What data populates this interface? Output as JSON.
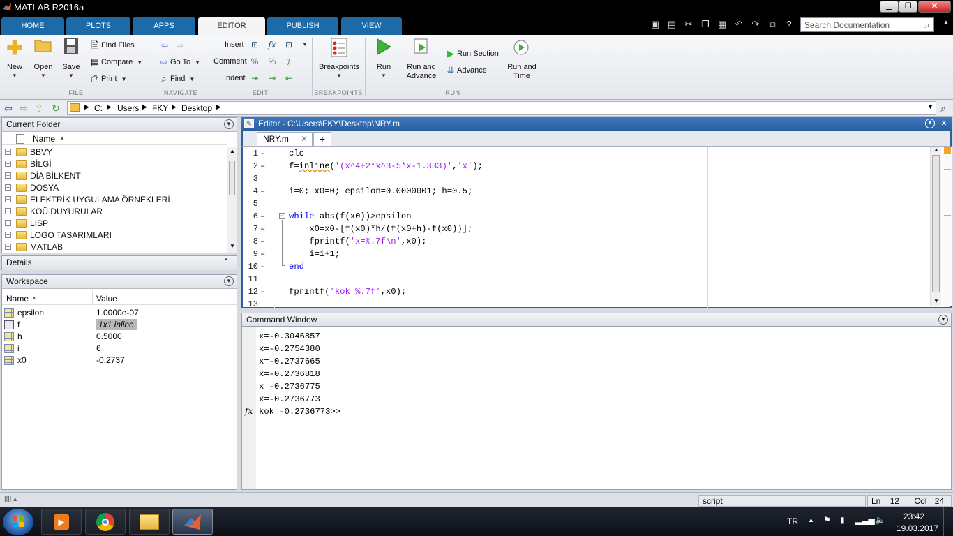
{
  "window": {
    "title": "MATLAB R2016a",
    "controls": {
      "minimize": "▁",
      "maximize": "❐",
      "close": "✕"
    }
  },
  "tabs": [
    {
      "label": "HOME",
      "active": false
    },
    {
      "label": "PLOTS",
      "active": false
    },
    {
      "label": "APPS",
      "active": false
    },
    {
      "label": "EDITOR",
      "active": true
    },
    {
      "label": "PUBLISH",
      "active": false
    },
    {
      "label": "VIEW",
      "active": false
    }
  ],
  "search": {
    "placeholder": "Search Documentation"
  },
  "ribbon": {
    "file": {
      "group_label": "FILE",
      "new": "New",
      "open": "Open",
      "save": "Save",
      "find_files": "Find Files",
      "compare": "Compare",
      "print": "Print"
    },
    "navigate": {
      "group_label": "NAVIGATE",
      "go_to": "Go To",
      "find": "Find"
    },
    "edit": {
      "group_label": "EDIT",
      "insert": "Insert",
      "comment": "Comment",
      "indent": "Indent",
      "fx": "fx"
    },
    "breakpoints": {
      "group_label": "BREAKPOINTS",
      "breakpoints": "Breakpoints"
    },
    "run": {
      "group_label": "RUN",
      "run": "Run",
      "run_and_advance_1": "Run and",
      "run_and_advance_2": "Advance",
      "run_section": "Run Section",
      "advance": "Advance",
      "run_and_time_1": "Run and",
      "run_and_time_2": "Time"
    }
  },
  "address": {
    "crumbs": [
      "C:",
      "Users",
      "FKY",
      "Desktop"
    ]
  },
  "current_folder": {
    "title": "Current Folder",
    "column": "Name",
    "items": [
      "BBVY",
      "BİLGİ",
      "DİA BİLKENT",
      "DOSYA",
      "ELEKTRİK UYGULAMA ÖRNEKLERİ",
      "KOÜ DUYURULAR",
      "LISP",
      "LOGO TASARIMLARI",
      "MATLAB"
    ]
  },
  "details": {
    "title": "Details"
  },
  "workspace": {
    "title": "Workspace",
    "columns": {
      "name": "Name",
      "value": "Value"
    },
    "vars": [
      {
        "name": "epsilon",
        "value": "1.0000e-07"
      },
      {
        "name": "f",
        "value": "1x1 inline"
      },
      {
        "name": "h",
        "value": "0.5000"
      },
      {
        "name": "i",
        "value": "6"
      },
      {
        "name": "x0",
        "value": "-0.2737"
      }
    ]
  },
  "editor": {
    "title": "Editor - C:\\Users\\FKY\\Desktop\\NRY.m",
    "tab": "NRY.m",
    "add_tab": "+",
    "lines": [
      {
        "n": "1",
        "bp": "–",
        "code": "clc"
      },
      {
        "n": "2",
        "bp": "–",
        "pre": "f=",
        "fn": "inline",
        "open": "(",
        "s1": "'(x^4+2*x^3-5*x-1.333)'",
        "mid": ",",
        "s2": "'x'",
        "close": ");"
      },
      {
        "n": "3",
        "bp": "",
        "code": ""
      },
      {
        "n": "4",
        "bp": "–",
        "code": "i=0; x0=0; epsilon=0.0000001; h=0.5;"
      },
      {
        "n": "5",
        "bp": "",
        "code": ""
      },
      {
        "n": "6",
        "bp": "–",
        "kw": "while",
        "code": " abs(f(x0))>epsilon"
      },
      {
        "n": "7",
        "bp": "–",
        "code": "    x0=x0-[f(x0)*h/(f(x0+h)-f(x0))];"
      },
      {
        "n": "8",
        "bp": "–",
        "pre": "    fprintf(",
        "s1": "'x=%.7f\\n'",
        "close": ",x0);"
      },
      {
        "n": "9",
        "bp": "–",
        "code": "    i=i+1;"
      },
      {
        "n": "10",
        "bp": "–",
        "kw": "end",
        "code": ""
      },
      {
        "n": "11",
        "bp": "",
        "code": ""
      },
      {
        "n": "12",
        "bp": "–",
        "pre": "fprintf(",
        "s1": "'kok=%.7f'",
        "close": ",x0);"
      },
      {
        "n": "13",
        "bp": "",
        "code": ""
      }
    ]
  },
  "command_window": {
    "title": "Command Window",
    "lines": [
      "x=-0.3046857",
      "x=-0.2754380",
      "x=-0.2737665",
      "x=-0.2736818",
      "x=-0.2736775",
      "x=-0.2736773",
      "kok=-0.2736773>>"
    ],
    "fx_label": "fx"
  },
  "status": {
    "mode": "script",
    "ln_label": "Ln",
    "ln": "12",
    "col_label": "Col",
    "col": "24"
  },
  "taskbar": {
    "lang": "TR",
    "time": "23:42",
    "date": "19.03.2017"
  }
}
